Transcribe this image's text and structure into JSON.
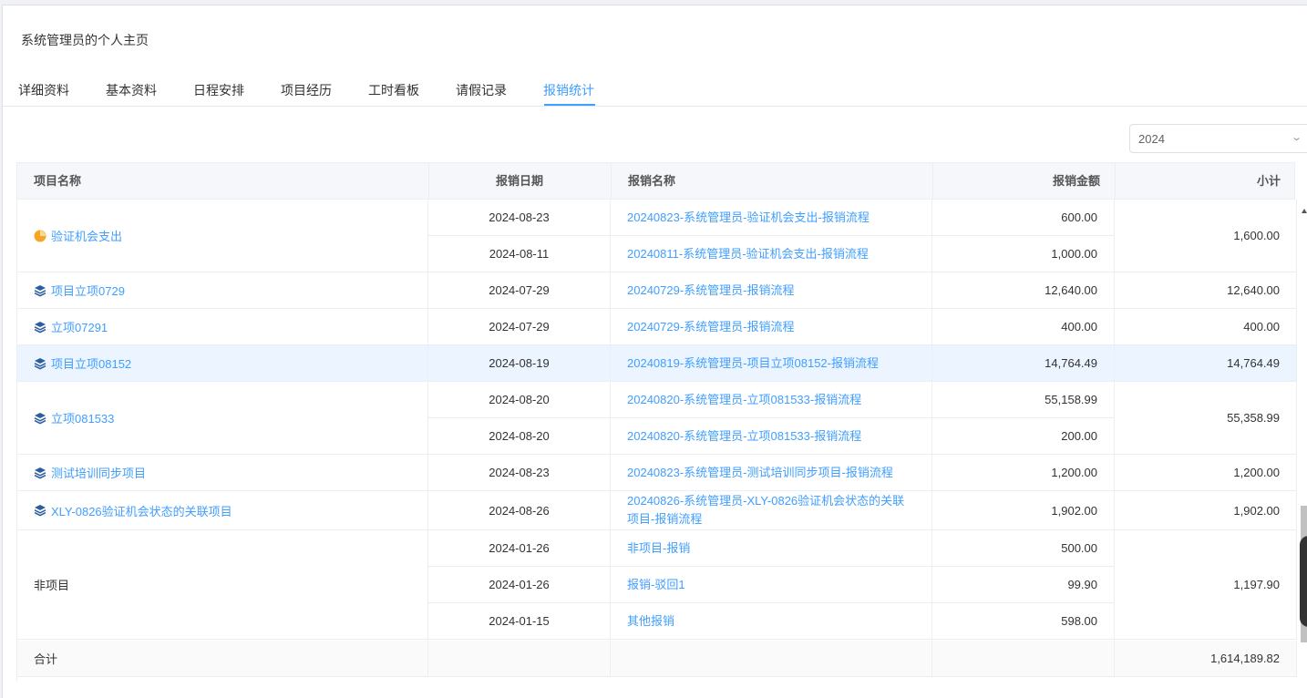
{
  "page_title": "系统管理员的个人主页",
  "tabs": [
    {
      "label": "详细资料"
    },
    {
      "label": "基本资料"
    },
    {
      "label": "日程安排"
    },
    {
      "label": "项目经历"
    },
    {
      "label": "工时看板"
    },
    {
      "label": "请假记录"
    },
    {
      "label": "报销统计"
    }
  ],
  "active_tab": "报销统计",
  "year_select": {
    "value": "2024"
  },
  "table": {
    "headers": {
      "project": "项目名称",
      "date": "报销日期",
      "name": "报销名称",
      "amount": "报销金额",
      "subtotal": "小计"
    },
    "groups": [
      {
        "project": "验证机会支出",
        "icon": "pie-chart-icon",
        "subtotal": "1,600.00",
        "rows": [
          {
            "date": "2024-08-23",
            "name": "20240823-系统管理员-验证机会支出-报销流程",
            "amount": "600.00"
          },
          {
            "date": "2024-08-11",
            "name": "20240811-系统管理员-验证机会支出-报销流程",
            "amount": "1,000.00"
          }
        ]
      },
      {
        "project": "项目立项0729",
        "icon": "layers-icon",
        "subtotal": "12,640.00",
        "rows": [
          {
            "date": "2024-07-29",
            "name": "20240729-系统管理员-报销流程",
            "amount": "12,640.00"
          }
        ]
      },
      {
        "project": "立项07291",
        "icon": "layers-icon",
        "subtotal": "400.00",
        "rows": [
          {
            "date": "2024-07-29",
            "name": "20240729-系统管理员-报销流程",
            "amount": "400.00"
          }
        ]
      },
      {
        "project": "项目立项08152",
        "icon": "layers-icon",
        "subtotal": "14,764.49",
        "rows": [
          {
            "date": "2024-08-19",
            "name": "20240819-系统管理员-项目立项08152-报销流程",
            "amount": "14,764.49"
          }
        ]
      },
      {
        "project": "立项081533",
        "icon": "layers-icon",
        "subtotal": "55,358.99",
        "rows": [
          {
            "date": "2024-08-20",
            "name": "20240820-系统管理员-立项081533-报销流程",
            "amount": "55,158.99"
          },
          {
            "date": "2024-08-20",
            "name": "20240820-系统管理员-立项081533-报销流程",
            "amount": "200.00"
          }
        ]
      },
      {
        "project": "测试培训同步项目",
        "icon": "layers-icon",
        "subtotal": "1,200.00",
        "rows": [
          {
            "date": "2024-08-23",
            "name": "20240823-系统管理员-测试培训同步项目-报销流程",
            "amount": "1,200.00"
          }
        ]
      },
      {
        "project": "XLY-0826验证机会状态的关联项目",
        "icon": "layers-icon",
        "subtotal": "1,902.00",
        "rows": [
          {
            "date": "2024-08-26",
            "name": "20240826-系统管理员-XLY-0826验证机会状态的关联项目-报销流程",
            "amount": "1,902.00"
          }
        ]
      },
      {
        "project": "非项目",
        "icon": null,
        "subtotal": "1,197.90",
        "rows": [
          {
            "date": "2024-01-26",
            "name": "非项目-报销",
            "amount": "500.00"
          },
          {
            "date": "2024-01-26",
            "name": "报销-驳回1",
            "amount": "99.90"
          },
          {
            "date": "2024-01-15",
            "name": "其他报销",
            "amount": "598.00"
          }
        ]
      }
    ],
    "total_label": "合计",
    "total": "1,614,189.82"
  },
  "colors": {
    "accent": "#409eff",
    "pie_icon": "#f5a623",
    "row_highlight": "#ecf5ff"
  }
}
